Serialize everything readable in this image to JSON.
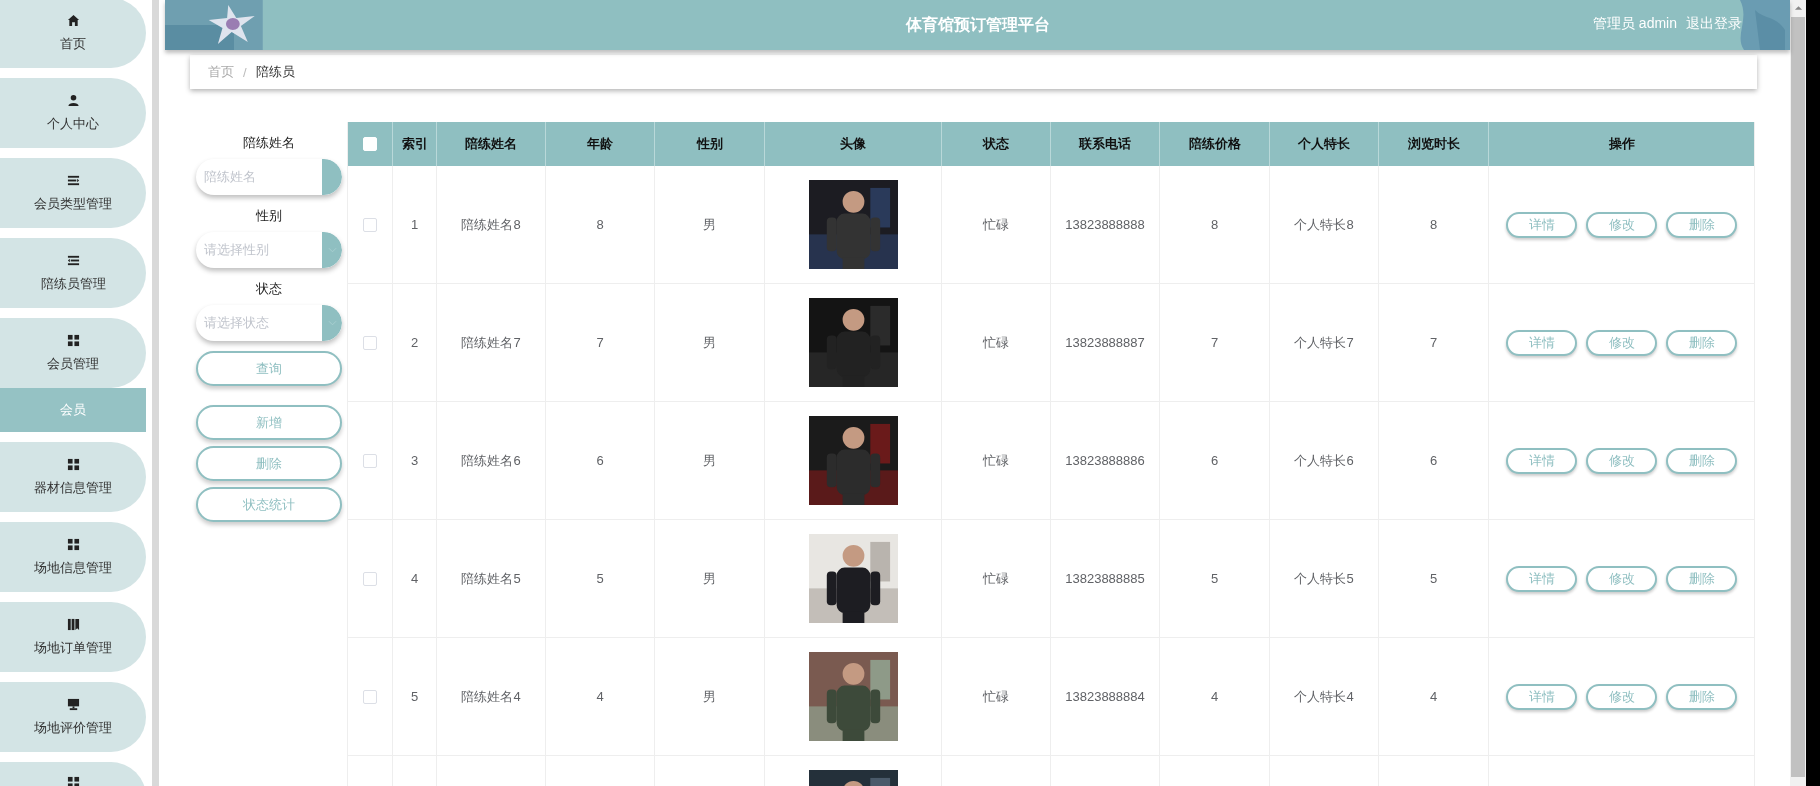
{
  "sidebar": {
    "items": [
      {
        "kind": "home",
        "label": "首页",
        "selected": false
      },
      {
        "kind": "user",
        "label": "个人中心",
        "selected": false
      },
      {
        "kind": "listright",
        "label": "会员类型管理",
        "selected": false
      },
      {
        "kind": "listleft",
        "label": "陪练员管理",
        "selected": false
      },
      {
        "kind": "grid",
        "label": "会员管理",
        "selected": false,
        "children": [
          {
            "label": "会员",
            "selected": true
          }
        ]
      },
      {
        "kind": "grid",
        "label": "器材信息管理",
        "selected": false
      },
      {
        "kind": "grid",
        "label": "场地信息管理",
        "selected": false
      },
      {
        "kind": "book",
        "label": "场地订单管理",
        "selected": false
      },
      {
        "kind": "monitor",
        "label": "场地评价管理",
        "selected": false
      },
      {
        "kind": "grid"
      }
    ]
  },
  "header": {
    "title": "体育馆预订管理平台",
    "user": "管理员 admin",
    "logout": "退出登录"
  },
  "breadcrumb": {
    "items": [
      "首页",
      "陪练员"
    ],
    "separator": "/"
  },
  "filters": [
    {
      "label": "陪练姓名",
      "kind": "text",
      "placeholder": "陪练姓名"
    },
    {
      "label": "性别",
      "kind": "select",
      "placeholder": "请选择性别"
    },
    {
      "label": "状态",
      "kind": "select",
      "placeholder": "请选择状态"
    }
  ],
  "search_button": "查询",
  "actions": [
    "新增",
    "删除",
    "状态统计"
  ],
  "table": {
    "select_all": {
      "checked": false
    },
    "columns": [
      "索引",
      "陪练姓名",
      "年龄",
      "性别",
      "头像",
      "状态",
      "联系电话",
      "陪练价格",
      "个人特长",
      "浏览时长",
      "操作"
    ],
    "rows": [
      {
        "checked": false,
        "index": "1",
        "name": "陪练姓名8",
        "age": "8",
        "gender": "男",
        "avatar": {
          "kind": "picture"
        },
        "status": "忙碌",
        "phone": "13823888888",
        "price": "8",
        "specialty": "个人特长8",
        "duration": "8",
        "actions": [
          "详情",
          "修改",
          "删除"
        ]
      },
      {
        "checked": false,
        "index": "2",
        "name": "陪练姓名7",
        "age": "7",
        "gender": "男",
        "avatar": {
          "kind": "picture"
        },
        "status": "忙碌",
        "phone": "13823888887",
        "price": "7",
        "specialty": "个人特长7",
        "duration": "7",
        "actions": [
          "详情",
          "修改",
          "删除"
        ]
      },
      {
        "checked": false,
        "index": "3",
        "name": "陪练姓名6",
        "age": "6",
        "gender": "男",
        "avatar": {
          "kind": "picture"
        },
        "status": "忙碌",
        "phone": "13823888886",
        "price": "6",
        "specialty": "个人特长6",
        "duration": "6",
        "actions": [
          "详情",
          "修改",
          "删除"
        ]
      },
      {
        "checked": false,
        "index": "4",
        "name": "陪练姓名5",
        "age": "5",
        "gender": "男",
        "avatar": {
          "kind": "picture"
        },
        "status": "忙碌",
        "phone": "13823888885",
        "price": "5",
        "specialty": "个人特长5",
        "duration": "5",
        "actions": [
          "详情",
          "修改",
          "删除"
        ]
      },
      {
        "checked": false,
        "index": "5",
        "name": "陪练姓名4",
        "age": "4",
        "gender": "男",
        "avatar": {
          "kind": "picture"
        },
        "status": "忙碌",
        "phone": "13823888884",
        "price": "4",
        "specialty": "个人特长4",
        "duration": "4",
        "actions": [
          "详情",
          "修改",
          "删除"
        ]
      },
      {
        "avatar": {
          "kind": "picture"
        }
      }
    ]
  }
}
